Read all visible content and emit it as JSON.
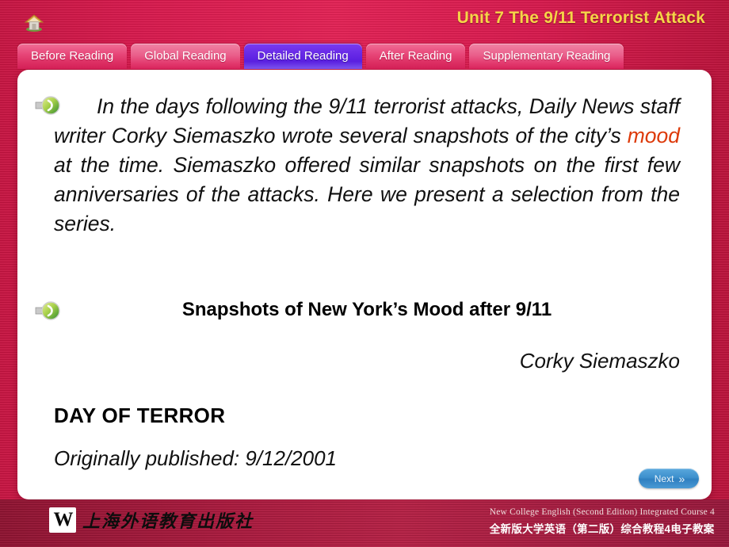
{
  "header": {
    "home_icon": "home-icon",
    "unit_title": "Unit 7  The 9/11 Terrorist Attack",
    "title_color": "#f5d547"
  },
  "tabs": [
    {
      "label": "Before Reading",
      "active": false
    },
    {
      "label": "Global Reading",
      "active": false
    },
    {
      "label": "Detailed Reading",
      "active": true
    },
    {
      "label": "After Reading",
      "active": false
    },
    {
      "label": "Supplementary Reading",
      "active": false
    }
  ],
  "content": {
    "speaker_icon_1": "speaker-icon",
    "speaker_icon_2": "speaker-icon",
    "paragraph_part1": "In the days following the 9/11 terrorist attacks, Daily News staff writer Corky Siemaszko wrote several snapshots of the city’s ",
    "paragraph_highlight": "mood",
    "paragraph_part2": " at the time. Siemaszko offered similar snapshots on the first few anniversaries of the attacks. Here we present a selection from the series.",
    "highlight_color": "#dd3a0a",
    "subheading": "Snapshots of New York’s Mood after 9/11",
    "byline": "Corky Siemaszko",
    "section_title": "DAY OF TERROR",
    "publication": "Originally published: 9/12/2001"
  },
  "next_button": {
    "label": "Next",
    "chevron": "»"
  },
  "footer": {
    "press_mark": "W",
    "press_name": "上海外语教育出版社",
    "course_en": "New College English (Second Edition) Integrated Course 4",
    "course_cn": "全新版大学英语（第二版）综合教程4电子教案"
  }
}
